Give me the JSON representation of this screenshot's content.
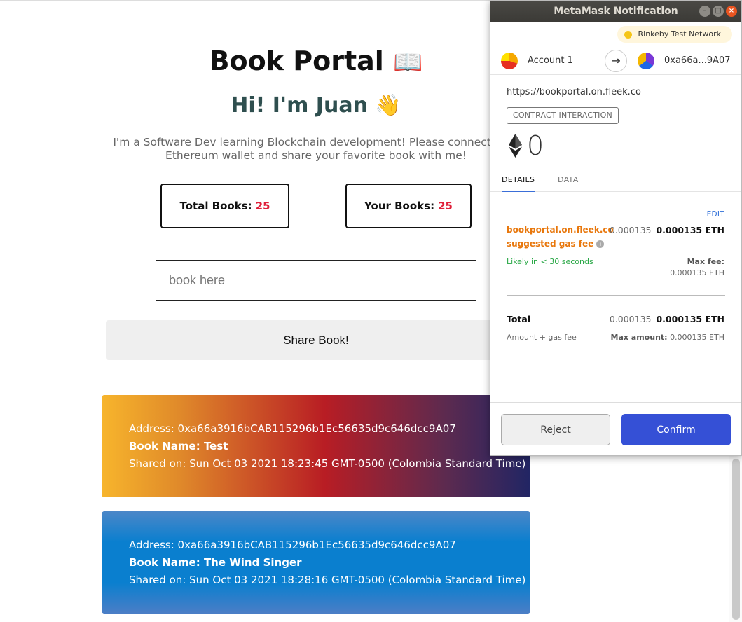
{
  "portal": {
    "title": "Book Portal",
    "title_emoji": "📖",
    "greeting": "Hi! I'm Juan",
    "greeting_emoji": "👋",
    "intro_line1": "I'm a Software Dev learning Blockchain development! Please connect your",
    "intro_line2": "Ethereum wallet and share your favorite book with me!",
    "total_books_label": "Total Books:",
    "total_books_value": "25",
    "your_books_label": "Your Books:",
    "your_books_value": "25",
    "book_input_placeholder": "book here",
    "share_button_label": "Share Book!",
    "books": [
      {
        "address": "Address: 0xa66a3916bCAB115296b1Ec56635d9c646dcc9A07",
        "name": "Book Name: Test",
        "shared": "Shared on: Sun Oct 03 2021 18:23:45 GMT-0500 (Colombia Standard Time)"
      },
      {
        "address": "Address: 0xa66a3916bCAB115296b1Ec56635d9c646dcc9A07",
        "name": "Book Name: The Wind Singer",
        "shared": "Shared on: Sun Oct 03 2021 18:28:16 GMT-0500 (Colombia Standard Time)"
      }
    ]
  },
  "metamask": {
    "window_title": "MetaMask Notification",
    "network": "Rinkeby Test Network",
    "from_account": "Account 1",
    "to_account": "0xa66a...9A07",
    "origin": "https://bookportal.on.fleek.co",
    "badge": "CONTRACT INTERACTION",
    "amount": "0",
    "tabs": {
      "details": "DETAILS",
      "data": "DATA"
    },
    "edit_label": "EDIT",
    "gas_origin": "bookportal.on.fleek.co",
    "gas_suggested": "suggested gas fee",
    "gas_value": "0.000135",
    "gas_value_eth": "0.000135 ETH",
    "likely": "Likely in < 30 seconds",
    "max_fee_label": "Max fee:",
    "max_fee_value": "0.000135 ETH",
    "total_label": "Total",
    "total_value": "0.000135",
    "total_value_eth": "0.000135 ETH",
    "amount_gas_label": "Amount + gas fee",
    "max_amount_label": "Max amount:",
    "max_amount_value": "0.000135 ETH",
    "reject_label": "Reject",
    "confirm_label": "Confirm",
    "colors": {
      "confirm": "#3550d6",
      "orange": "#e8770c",
      "green": "#28a745",
      "number_accent": "#e0203a"
    }
  }
}
